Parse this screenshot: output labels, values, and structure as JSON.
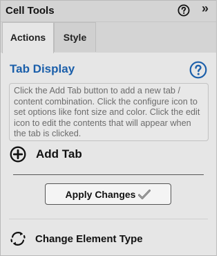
{
  "panel": {
    "title": "Cell Tools",
    "help_icon": "help-circle-icon",
    "collapse_icon": "double-chevron-right-icon",
    "collapse_glyph": "»"
  },
  "tabs": [
    {
      "label": "Actions",
      "active": true
    },
    {
      "label": "Style",
      "active": false
    }
  ],
  "section": {
    "title": "Tab Display",
    "help_icon": "help-circle-icon",
    "description": "Click the Add Tab button to add a new tab / content combination. Click the configure icon to set options like font size and color. Click the edit icon to edit the contents that will appear when the tab is clicked."
  },
  "add_tab": {
    "label": "Add Tab",
    "icon": "plus-circle-icon"
  },
  "apply_button": {
    "label": "Apply Changes",
    "icon": "checkmark-icon"
  },
  "change_type": {
    "label": "Change Element Type",
    "icon": "cycle-arrows-icon"
  },
  "colors": {
    "accent": "#1b5faa",
    "panel_bg": "#e6e6e6",
    "titlebar_bg": "#d4d4d4"
  }
}
